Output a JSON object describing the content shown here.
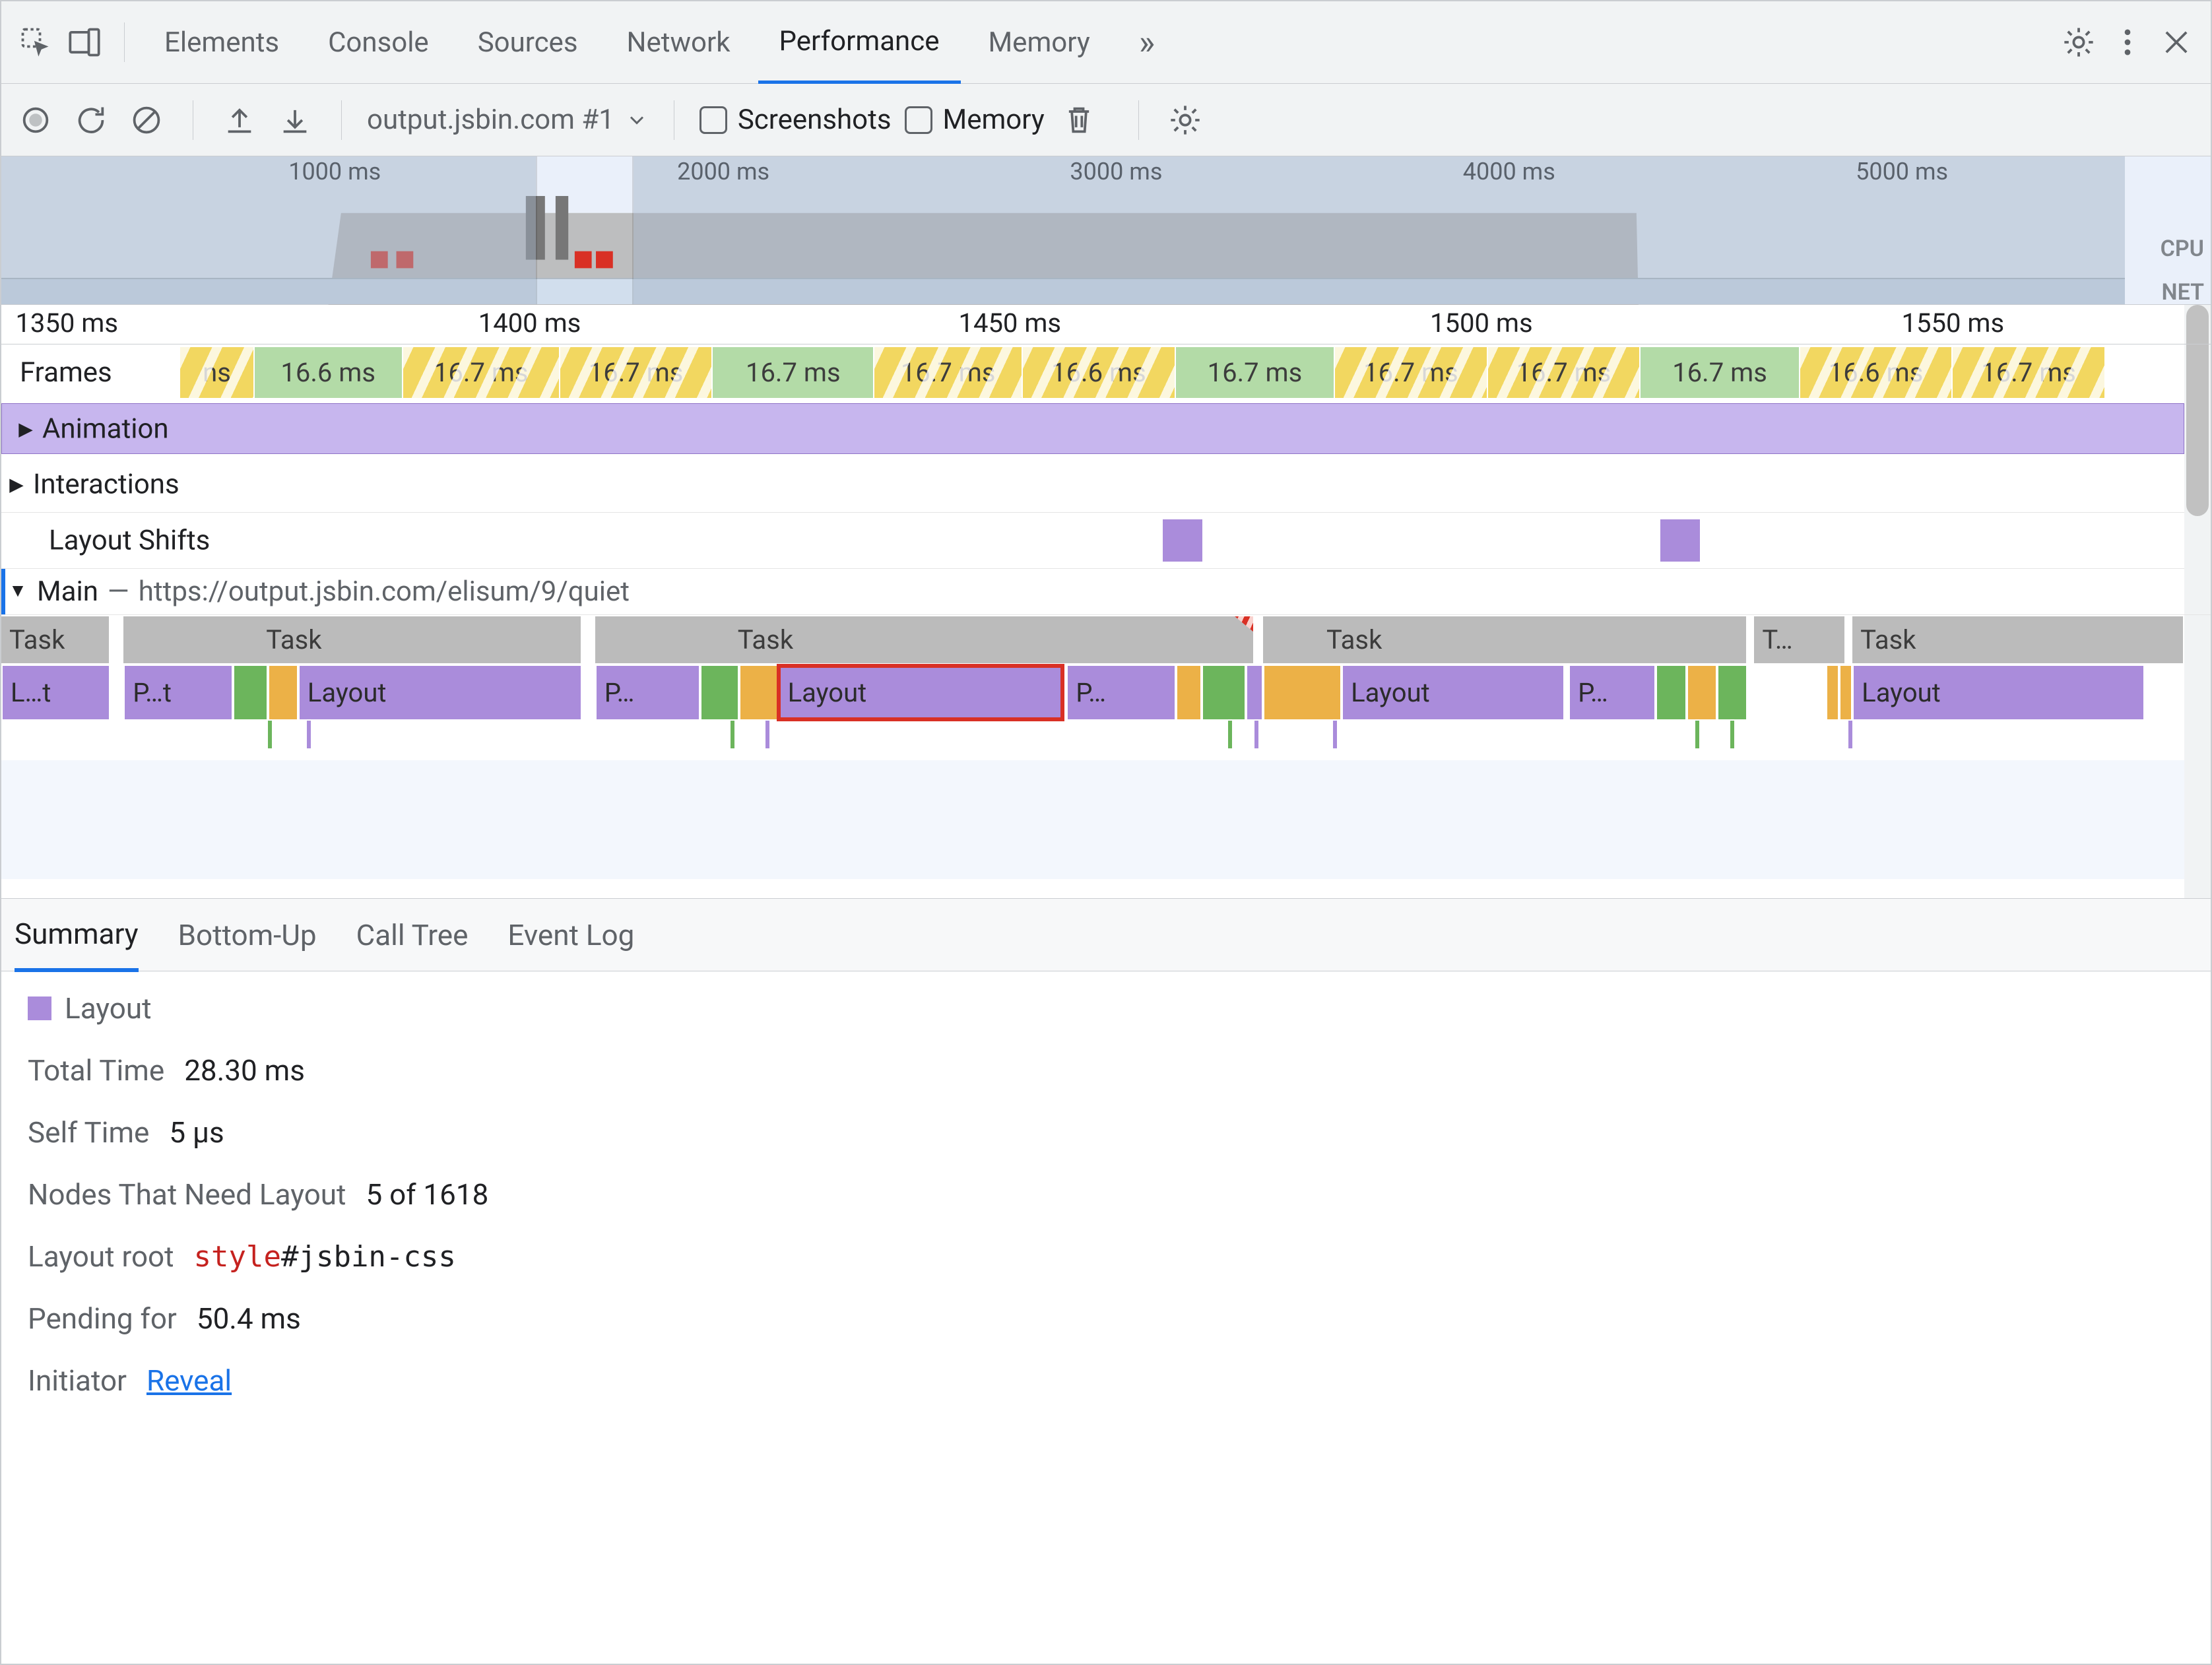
{
  "top_tabs": {
    "items": [
      "Elements",
      "Console",
      "Sources",
      "Network",
      "Performance",
      "Memory"
    ],
    "active_index": 4,
    "more_glyph": "»"
  },
  "toolbar": {
    "selector_label": "output.jsbin.com #1",
    "screenshots_label": "Screenshots",
    "memory_label": "Memory"
  },
  "overview": {
    "ticks": [
      "1000 ms",
      "2000 ms",
      "3000 ms",
      "4000 ms",
      "5000 ms"
    ],
    "cpu_label": "CPU",
    "net_label": "NET"
  },
  "ruler": {
    "ticks": [
      "1350 ms",
      "1400 ms",
      "1450 ms",
      "1500 ms",
      "1550 ms"
    ]
  },
  "tracks": {
    "frames_label": "Frames",
    "frames": [
      {
        "w": 3.4,
        "bad": true,
        "label": "ns"
      },
      {
        "w": 6.8,
        "bad": false,
        "label": "16.6 ms"
      },
      {
        "w": 7.2,
        "bad": true,
        "label": "16.7 ms"
      },
      {
        "w": 7.0,
        "bad": true,
        "label": "16.7 ms"
      },
      {
        "w": 7.4,
        "bad": false,
        "label": "16.7 ms"
      },
      {
        "w": 6.8,
        "bad": true,
        "label": "16.7 ms"
      },
      {
        "w": 7.0,
        "bad": true,
        "label": "16.6 ms"
      },
      {
        "w": 7.3,
        "bad": false,
        "label": "16.7 ms"
      },
      {
        "w": 7.0,
        "bad": true,
        "label": "16.7 ms"
      },
      {
        "w": 7.0,
        "bad": true,
        "label": "16.7 ms"
      },
      {
        "w": 7.3,
        "bad": false,
        "label": "16.7 ms"
      },
      {
        "w": 7.0,
        "bad": true,
        "label": "16.6 ms"
      },
      {
        "w": 7.0,
        "bad": true,
        "label": "16.7 ms"
      }
    ],
    "animation_label": "Animation",
    "interactions_label": "Interactions",
    "layout_shifts_label": "Layout Shifts",
    "main_label_prefix": "Main",
    "main_label_dash": "—",
    "main_url": "https://output.jsbin.com/elisum/9/quiet",
    "tasks": [
      {
        "x": 0,
        "w": 5.0,
        "label": "Task"
      },
      {
        "x": 5.6,
        "w": 21.0,
        "label": "Task",
        "label_offset": 9
      },
      {
        "x": 27.2,
        "w": 30.2,
        "label": "Task",
        "label_offset": 9,
        "long": true
      },
      {
        "x": 57.8,
        "w": 22.2,
        "label": "Task",
        "label_offset": 4
      },
      {
        "x": 80.3,
        "w": 4.2,
        "label": "T…"
      },
      {
        "x": 84.8,
        "w": 15.2,
        "label": "Task"
      }
    ],
    "flame": [
      {
        "x": 0,
        "w": 5.0,
        "c": "purple",
        "label": "L…t"
      },
      {
        "x": 5.6,
        "w": 5.0,
        "c": "purple",
        "label": "P…t"
      },
      {
        "x": 10.6,
        "w": 1.6,
        "c": "green",
        "label": ""
      },
      {
        "x": 12.2,
        "w": 1.4,
        "c": "orange",
        "label": ""
      },
      {
        "x": 13.6,
        "w": 13.0,
        "c": "purple",
        "label": "Layout"
      },
      {
        "x": 27.2,
        "w": 4.8,
        "c": "purple",
        "label": "P…"
      },
      {
        "x": 32.0,
        "w": 1.8,
        "c": "green",
        "label": ""
      },
      {
        "x": 33.8,
        "w": 1.8,
        "c": "orange",
        "label": ""
      },
      {
        "x": 35.6,
        "w": 13.0,
        "c": "purple",
        "label": "Layout",
        "selected": true
      },
      {
        "x": 48.8,
        "w": 5.0,
        "c": "purple",
        "label": "P…"
      },
      {
        "x": 53.8,
        "w": 1.2,
        "c": "orange",
        "label": ""
      },
      {
        "x": 55.0,
        "w": 2.0,
        "c": "green",
        "label": ""
      },
      {
        "x": 57.0,
        "w": 0.8,
        "c": "purple",
        "label": ""
      },
      {
        "x": 57.8,
        "w": 3.6,
        "c": "orange",
        "label": ""
      },
      {
        "x": 61.4,
        "w": 10.2,
        "c": "purple",
        "label": "Layout"
      },
      {
        "x": 71.8,
        "w": 4.0,
        "c": "purple",
        "label": "P…"
      },
      {
        "x": 75.8,
        "w": 1.4,
        "c": "green",
        "label": ""
      },
      {
        "x": 77.2,
        "w": 1.4,
        "c": "orange",
        "label": ""
      },
      {
        "x": 78.6,
        "w": 1.4,
        "c": "green",
        "label": ""
      },
      {
        "x": 83.6,
        "w": 0.6,
        "c": "orange",
        "label": ""
      },
      {
        "x": 84.2,
        "w": 0.6,
        "c": "orange",
        "label": ""
      },
      {
        "x": 84.8,
        "w": 13.4,
        "c": "purple",
        "label": "Layout"
      }
    ],
    "ticks_below": [
      {
        "x": 12.2,
        "c": "green"
      },
      {
        "x": 14.0,
        "c": "purple"
      },
      {
        "x": 33.4,
        "c": "green"
      },
      {
        "x": 35.0,
        "c": "purple"
      },
      {
        "x": 56.2,
        "c": "green"
      },
      {
        "x": 57.4,
        "c": "purple"
      },
      {
        "x": 61.0,
        "c": "purple"
      },
      {
        "x": 77.6,
        "c": "green"
      },
      {
        "x": 79.2,
        "c": "green"
      },
      {
        "x": 84.6,
        "c": "purple"
      }
    ]
  },
  "details": {
    "tabs": [
      "Summary",
      "Bottom-Up",
      "Call Tree",
      "Event Log"
    ],
    "active_index": 0,
    "event_name": "Layout",
    "rows": {
      "total_time_label": "Total Time",
      "total_time_value": "28.30 ms",
      "self_time_label": "Self Time",
      "self_time_value": "5 μs",
      "nodes_label": "Nodes That Need Layout",
      "nodes_value": "5 of 1618",
      "layout_root_label": "Layout root",
      "layout_root_tag": "style",
      "layout_root_selector": "#jsbin-css",
      "pending_label": "Pending for",
      "pending_value": "50.4 ms",
      "initiator_label": "Initiator",
      "reveal_text": "Reveal"
    }
  }
}
